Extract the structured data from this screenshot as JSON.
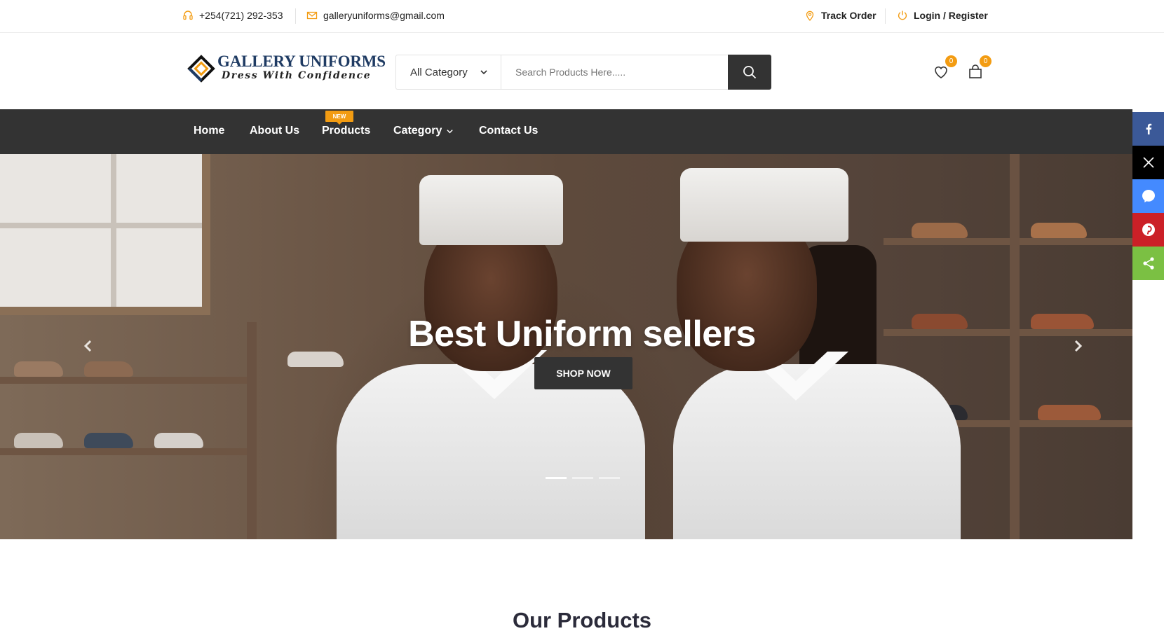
{
  "topbar": {
    "phone": "+254(721) 292-353",
    "email": "galleryuniforms@gmail.com",
    "track_order": "Track Order",
    "login_register": "Login / Register"
  },
  "header": {
    "logo_line1": "GALLERY UNIFORMS",
    "logo_line2": "Dress With Confidence",
    "category_select": "All Category",
    "search_placeholder": "Search Products Here.....",
    "wishlist_count": "0",
    "cart_count": "0"
  },
  "nav": {
    "items": [
      {
        "label": "Home"
      },
      {
        "label": "About Us"
      },
      {
        "label": "Products"
      },
      {
        "label": "Category"
      },
      {
        "label": "Contact Us"
      }
    ],
    "new_badge": "NEW"
  },
  "hero": {
    "title": "Best Uniform sellers",
    "button": "SHOP NOW",
    "slide_count": 3,
    "active_slide": 1
  },
  "social": {
    "items": [
      "facebook-icon",
      "x-icon",
      "messenger-icon",
      "pinterest-icon",
      "share-icon"
    ]
  },
  "colors": {
    "accent": "#f39c12",
    "nav_bg": "#333333",
    "facebook": "#3b5998",
    "x": "#000000",
    "messenger": "#448aff",
    "pinterest": "#cb2027",
    "share": "#7bc043"
  },
  "section": {
    "title": "Our Products"
  }
}
